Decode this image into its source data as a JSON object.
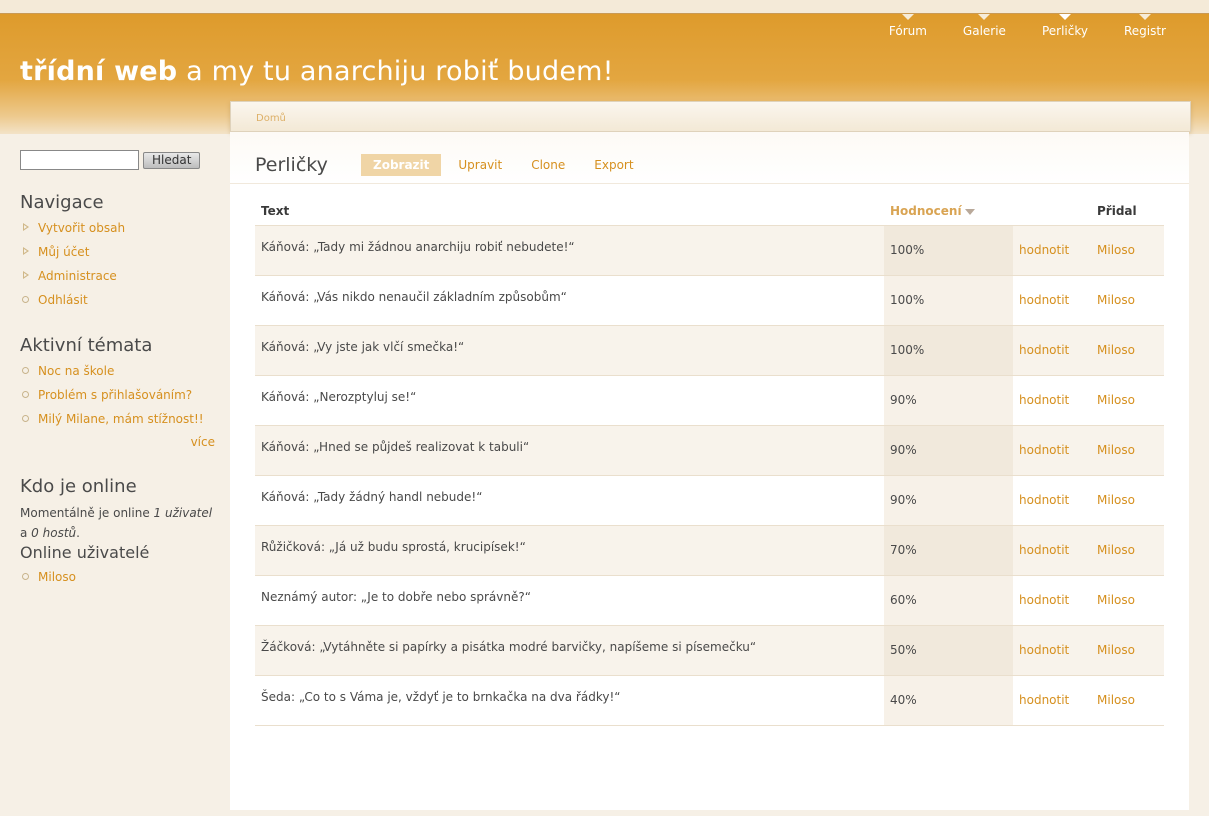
{
  "header": {
    "site_name": "třídní web",
    "slogan": "a my tu anarchiju robiť budem!",
    "primary_links": [
      {
        "label": "Fórum"
      },
      {
        "label": "Galerie"
      },
      {
        "label": "Perličky",
        "active": true
      },
      {
        "label": "Registr"
      }
    ]
  },
  "search": {
    "value": "",
    "button_label": "Hledat"
  },
  "sidebar": {
    "navigation": {
      "title": "Navigace",
      "items": [
        "Vytvořit obsah",
        "Můj účet",
        "Administrace",
        "Odhlásit"
      ]
    },
    "active_topics": {
      "title": "Aktivní témata",
      "items": [
        "Noc na škole",
        "Problém s přihlašováním?",
        "Milý Milane, mám stížnost!!"
      ],
      "more": "více"
    },
    "online": {
      "title": "Kdo je online",
      "text_before": "Momentálně je online ",
      "users_count": "1 uživatel",
      "text_middle": " a ",
      "guests_count": "0 hostů",
      "text_after": ".",
      "users_title": "Online uživatelé",
      "users": [
        "Miloso"
      ]
    }
  },
  "breadcrumb": {
    "home": "Domů"
  },
  "page": {
    "title": "Perličky",
    "tabs": [
      {
        "label": "Zobrazit",
        "active": true
      },
      {
        "label": "Upravit"
      },
      {
        "label": "Clone"
      },
      {
        "label": "Export"
      }
    ]
  },
  "table": {
    "headers": {
      "text": "Text",
      "rating": "Hodnocení",
      "action": "",
      "author": "Přidal"
    },
    "rows": [
      {
        "text": "Káňová: „Tady mi žádnou anarchiju robiť nebudete!“",
        "rating": "100%",
        "action": "hodnotit",
        "author": "Miloso"
      },
      {
        "text": "Káňová: „Vás nikdo nenaučil základním způsobům“",
        "rating": "100%",
        "action": "hodnotit",
        "author": "Miloso"
      },
      {
        "text": "Káňová: „Vy jste jak vlčí smečka!“",
        "rating": "100%",
        "action": "hodnotit",
        "author": "Miloso"
      },
      {
        "text": "Káňová: „Nerozptyluj se!“",
        "rating": "90%",
        "action": "hodnotit",
        "author": "Miloso"
      },
      {
        "text": "Káňová: „Hned se půjdeš realizovat k tabuli“",
        "rating": "90%",
        "action": "hodnotit",
        "author": "Miloso"
      },
      {
        "text": "Káňová: „Tady žádný handl nebude!“",
        "rating": "90%",
        "action": "hodnotit",
        "author": "Miloso"
      },
      {
        "text": "Růžičková: „Já už budu sprostá, krucipísek!“",
        "rating": "70%",
        "action": "hodnotit",
        "author": "Miloso"
      },
      {
        "text": "Neznámý autor: „Je to dobře nebo správně?“",
        "rating": "60%",
        "action": "hodnotit",
        "author": "Miloso"
      },
      {
        "text": "Žáčková: „Vytáhněte si papírky a pisátka modré barvičky, napíšeme si písemečku“",
        "rating": "50%",
        "action": "hodnotit",
        "author": "Miloso"
      },
      {
        "text": "Šeda: „Co to s Váma je, vždyť je to brnkačka na dva řádky!“",
        "rating": "40%",
        "action": "hodnotit",
        "author": "Miloso"
      }
    ]
  },
  "colors": {
    "accent": "#d6901f",
    "header_bg": "#de9b2c",
    "tab_active_bg": "#f0d5a6"
  }
}
